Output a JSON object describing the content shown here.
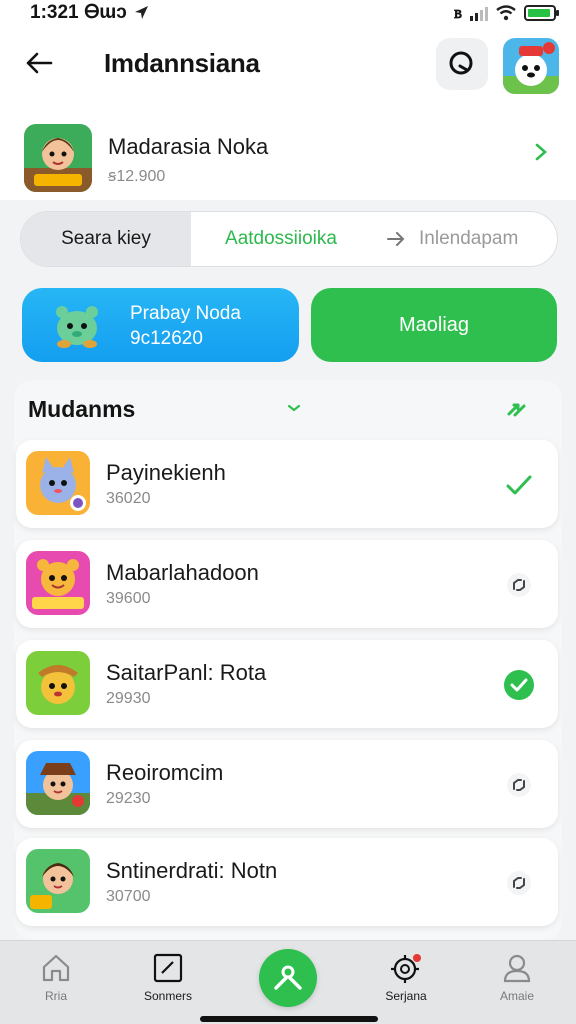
{
  "status_bar": {
    "time": "1:321",
    "carrier_text": "Ꮎɯɔ",
    "signal_text": "ᏼ"
  },
  "header": {
    "title": "Imdannsiana"
  },
  "featured": {
    "title": "Madarasia Noka",
    "subtitle": "ꞩ12.900"
  },
  "segment": {
    "items": [
      "Seara kiey",
      "Aatdossiioika",
      "Inlendapam"
    ]
  },
  "actions": {
    "primary_line1": "Prabay Noda",
    "primary_line2": "9c12620",
    "secondary": "Maoliag"
  },
  "section": {
    "title": "Mudanms",
    "items": [
      {
        "title": "Payinekienh",
        "subtitle": "36020",
        "status": "check",
        "accent": "#f9b235"
      },
      {
        "title": "Mabarlahadoon",
        "subtitle": "39600",
        "status": "sync",
        "accent": "#ff5fa2"
      },
      {
        "title": "SaitarPanl: Rota",
        "subtitle": "29930",
        "status": "done",
        "accent": "#7ccf3a"
      },
      {
        "title": "Reoiromcim",
        "subtitle": "29230",
        "status": "sync",
        "accent": "#3aa0ff"
      },
      {
        "title": "Sntinerdrati: Notn",
        "subtitle": "30700",
        "status": "sync",
        "accent": "#55c26c"
      }
    ]
  },
  "bottom_nav": {
    "items": [
      {
        "label": "Rria",
        "icon": "home-icon"
      },
      {
        "label": "Sonmers",
        "icon": "edit-icon"
      },
      {
        "label": "Serjana",
        "icon": "gear-icon"
      },
      {
        "label": "Amaie",
        "icon": "person-icon"
      }
    ]
  },
  "colors": {
    "brand_green": "#2ebf4f",
    "brand_blue": "#1ca7f2",
    "text_muted": "#8a8a8a"
  }
}
